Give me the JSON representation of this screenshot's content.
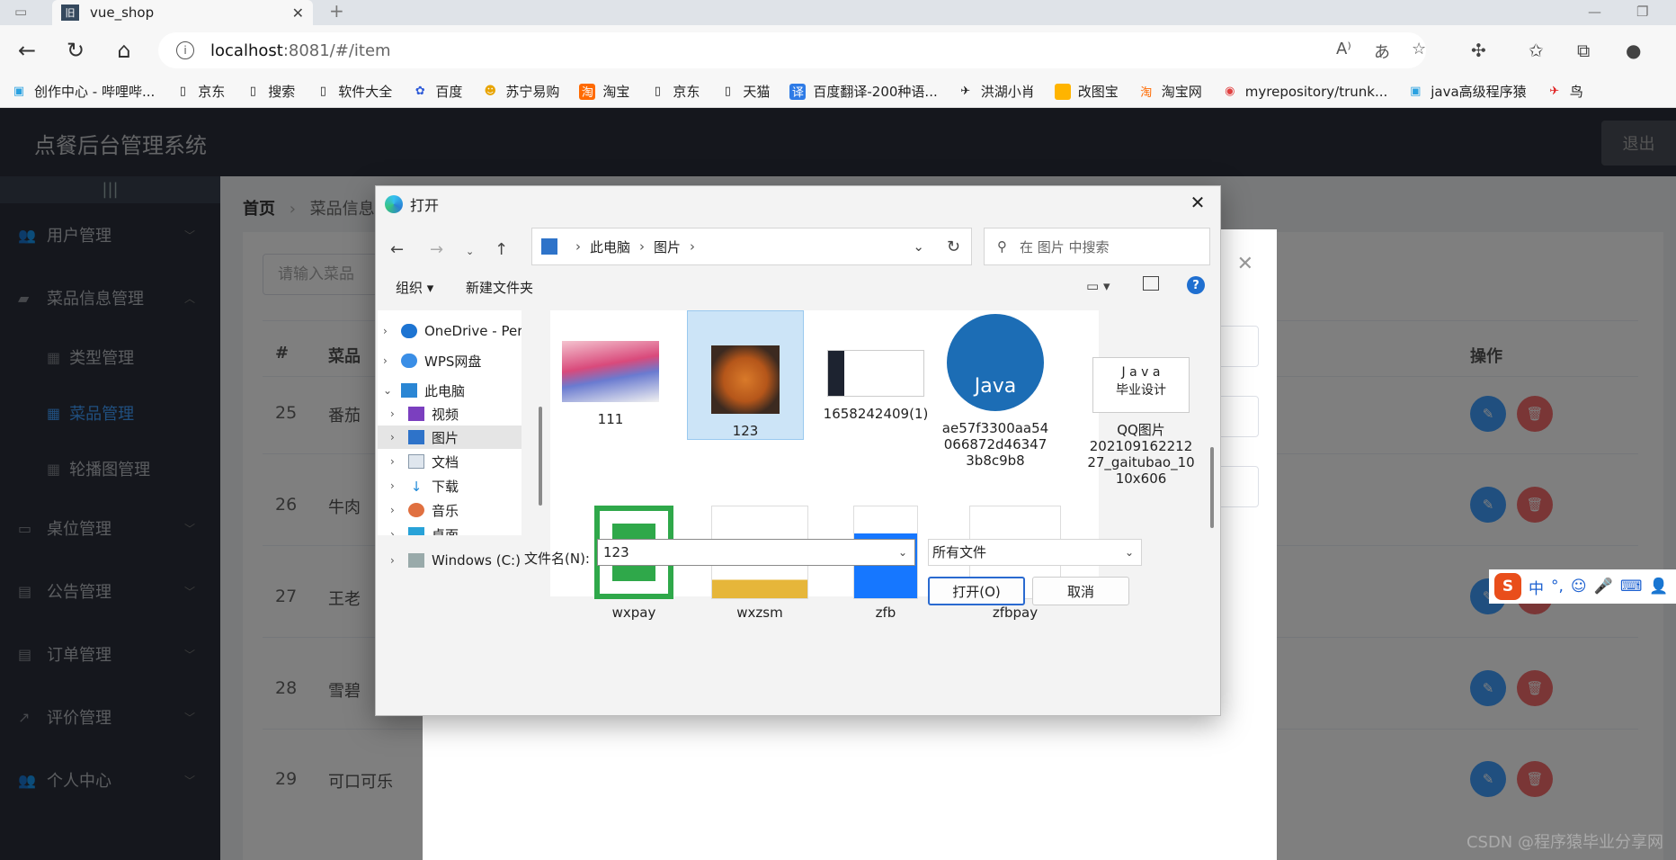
{
  "browser": {
    "tab_title": "vue_shop",
    "url_host": "localhost",
    "url_path": ":8081/#/item",
    "bookmarks": [
      "创作中心 - 哔哩哔...",
      "京东",
      "搜索",
      "软件大全",
      "百度",
      "苏宁易购",
      "淘宝",
      "京东",
      "天猫",
      "百度翻译-200种语...",
      "洪湖小肖",
      "改图宝",
      "淘宝网",
      "myrepository/trunk...",
      "java高级程序猿",
      "鸟"
    ]
  },
  "app": {
    "title": "点餐后台管理系统",
    "logout": "退出",
    "collapse": "|||",
    "menu": {
      "users": "用户管理",
      "dishes": "菜品信息管理",
      "types": "类型管理",
      "dish_mgmt": "菜品管理",
      "carousel": "轮播图管理",
      "tables": "桌位管理",
      "notices": "公告管理",
      "orders": "订单管理",
      "reviews": "评价管理",
      "profile": "个人中心"
    },
    "breadcrumb": {
      "home": "首页",
      "current": "菜品信息管"
    },
    "search_placeholder": "请输入菜品",
    "table_headers": {
      "num": "#",
      "name": "菜品",
      "actions": "操作"
    },
    "rows": [
      {
        "num": "25",
        "name": "番茄"
      },
      {
        "num": "26",
        "name": "牛肉"
      },
      {
        "num": "27",
        "name": "王老"
      },
      {
        "num": "28",
        "name": "雪碧"
      },
      {
        "num": "29",
        "name": "可口可乐"
      }
    ]
  },
  "file_dialog": {
    "title": "打开",
    "path": [
      "此电脑",
      "图片"
    ],
    "search_placeholder": "在 图片 中搜索",
    "organize": "组织",
    "new_folder": "新建文件夹",
    "help": "?",
    "tree": [
      "OneDrive - Perso",
      "WPS网盘",
      "此电脑",
      "视频",
      "图片",
      "文档",
      "下载",
      "音乐",
      "桌面",
      "Windows (C:)"
    ],
    "files": [
      "111",
      "123",
      "1658242409(1)",
      "ae57f3300aa54066872d463473b8c9b8",
      "QQ图片20210916221227_gaitubao_1010x606",
      "wxpay",
      "wxzsm",
      "zfb",
      "zfbpay"
    ],
    "files_display": {
      "ae": [
        "ae57f3300aa54",
        "066872d46347",
        "3b8c9b8"
      ],
      "qq": [
        "QQ图片",
        "202109162212",
        "27_gaitubao_10",
        "10x606"
      ]
    },
    "thumb_text": {
      "java": "Java",
      "grad1": "J a v a",
      "grad2": "毕业设计"
    },
    "filename_label": "文件名(N):",
    "filename_value": "123",
    "filter": "所有文件",
    "open": "打开(O)",
    "cancel": "取消"
  },
  "ime": {
    "lang": "中",
    "punct": "°,"
  },
  "watermark": "CSDN @程序猿毕业分享网"
}
